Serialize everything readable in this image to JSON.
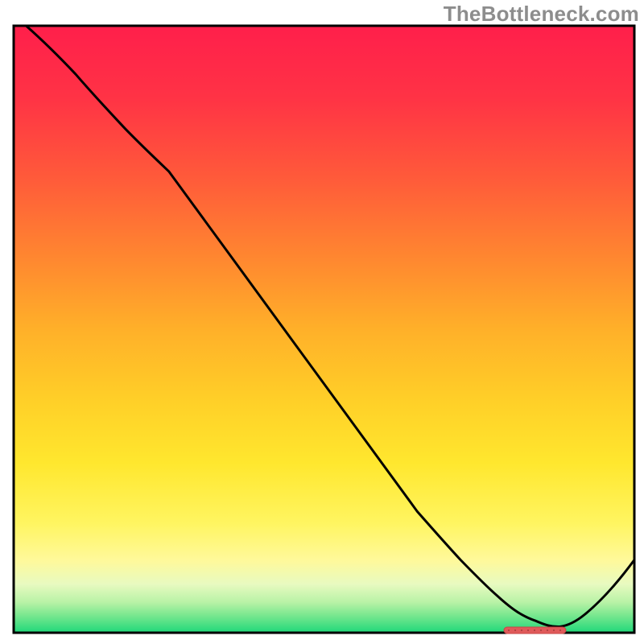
{
  "watermark": "TheBottleneck.com",
  "chart_data": {
    "type": "line",
    "title": "",
    "xlabel": "",
    "ylabel": "",
    "xlim": [
      0,
      100
    ],
    "ylim": [
      0,
      100
    ],
    "grid": false,
    "annotations": [
      {
        "text": "TheBottleneck.com",
        "position": "top-right"
      }
    ],
    "background_gradient": {
      "type": "vertical",
      "stops": [
        {
          "y": 0,
          "color": "#ff1f4b"
        },
        {
          "y": 25,
          "color": "#ff5a3a"
        },
        {
          "y": 50,
          "color": "#ffb029"
        },
        {
          "y": 70,
          "color": "#ffe72e"
        },
        {
          "y": 88,
          "color": "#fff99a"
        },
        {
          "y": 94,
          "color": "#c4f4aa"
        },
        {
          "y": 100,
          "color": "#1fd87a"
        }
      ]
    },
    "series": [
      {
        "name": "curve",
        "x": [
          2,
          10,
          18,
          25,
          35,
          45,
          55,
          65,
          72,
          78,
          84,
          88,
          92,
          100
        ],
        "y": [
          100,
          92,
          83,
          76,
          62,
          48,
          34,
          20,
          12,
          6,
          2,
          1,
          3,
          12
        ]
      }
    ],
    "baseline_marker": {
      "x_start": 79,
      "x_end": 89,
      "y": 0,
      "color": "#e05a5a"
    }
  },
  "colors": {
    "frame": "#000000",
    "curve": "#000000",
    "marker": "#e05a5a"
  }
}
